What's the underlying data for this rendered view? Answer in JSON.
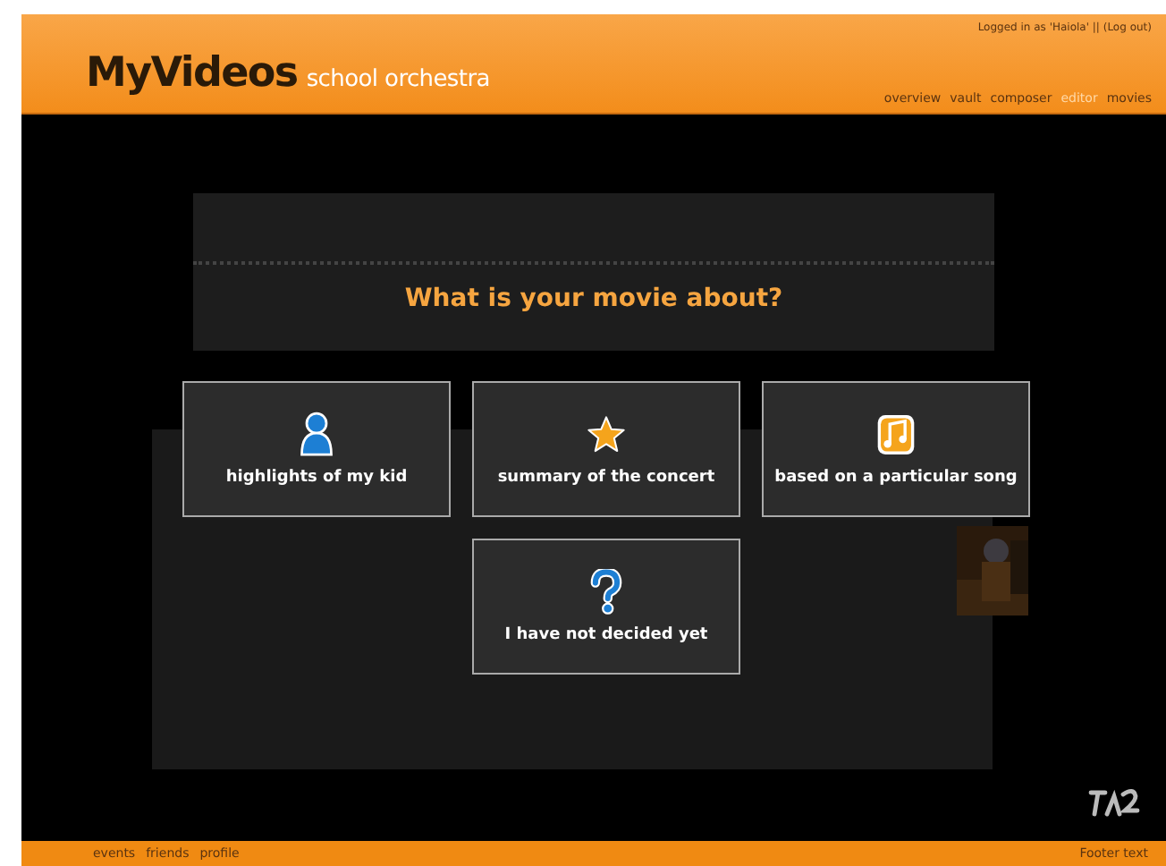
{
  "header": {
    "logo": "MyVideos",
    "subtitle": "school orchestra",
    "login": "Logged in as 'Haiola' || (Log out)",
    "nav": [
      {
        "label": "overview",
        "selected": false
      },
      {
        "label": "vault",
        "selected": false
      },
      {
        "label": "composer",
        "selected": false
      },
      {
        "label": "editor",
        "selected": true
      },
      {
        "label": "movies",
        "selected": false
      }
    ]
  },
  "dialog": {
    "question": "What is your movie about?",
    "options": [
      {
        "label": "highlights of my kid",
        "kind": "person"
      },
      {
        "label": "summary of the concert",
        "kind": "star"
      },
      {
        "label": "based on a particular song",
        "kind": "music"
      },
      {
        "label": "I have not decided yet",
        "kind": "question"
      }
    ]
  },
  "footer": {
    "links": [
      "events",
      "friends",
      "profile"
    ],
    "note": "Footer text"
  }
}
